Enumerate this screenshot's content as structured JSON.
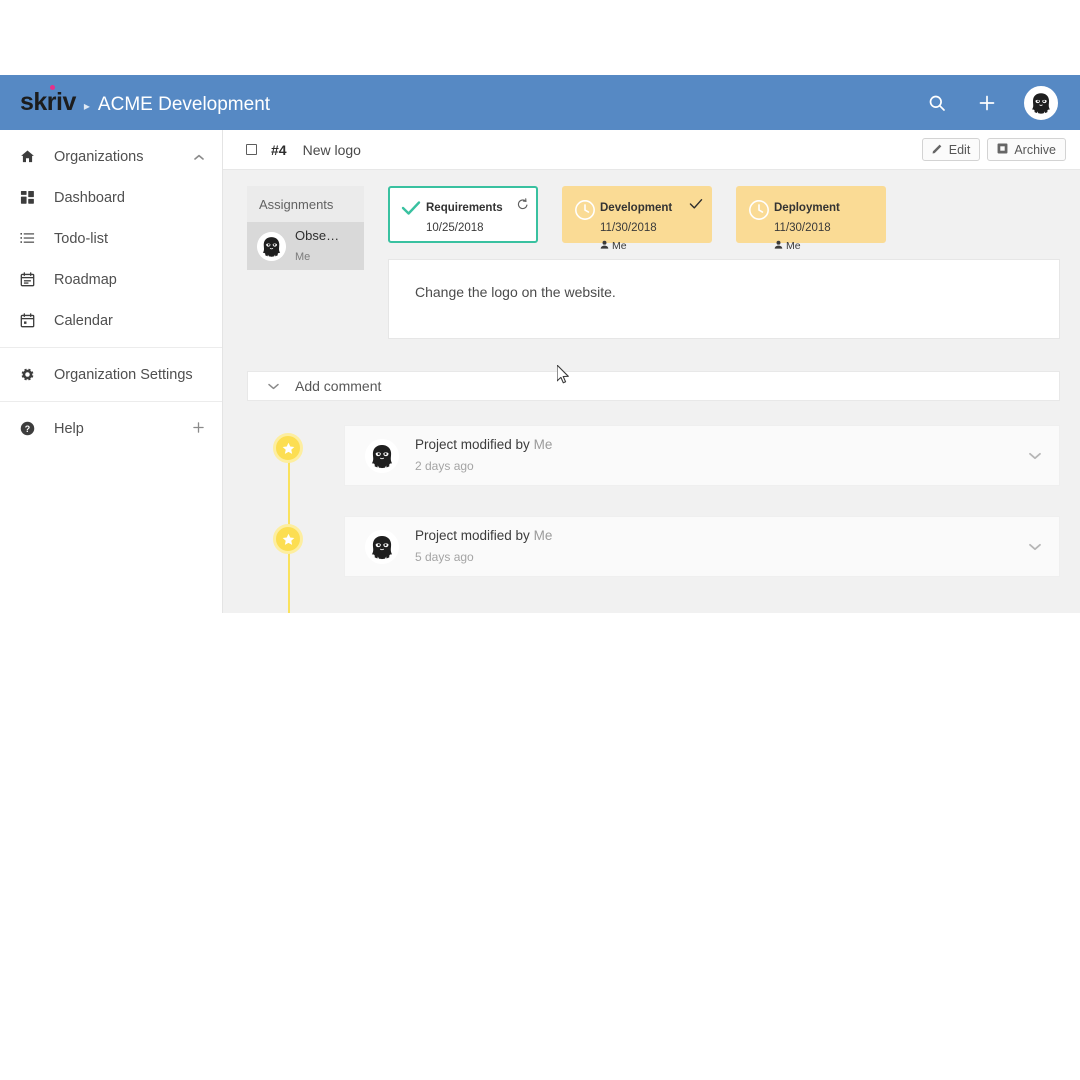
{
  "header": {
    "logo_text": "skriv",
    "separator": "▸",
    "project_title": "ACME Development",
    "search_icon": "search-icon",
    "add_icon": "plus-icon",
    "avatar_icon": "user-avatar"
  },
  "sidebar": {
    "groups": [
      {
        "items": [
          {
            "label": "Organizations",
            "icon": "home-icon",
            "tail": "chevron-up-icon"
          },
          {
            "label": "Dashboard",
            "icon": "grid-icon",
            "tail": ""
          },
          {
            "label": "Todo-list",
            "icon": "list-icon",
            "tail": ""
          },
          {
            "label": "Roadmap",
            "icon": "roadmap-calendar-icon",
            "tail": ""
          },
          {
            "label": "Calendar",
            "icon": "calendar-icon",
            "tail": ""
          }
        ]
      },
      {
        "items": [
          {
            "label": "Organization Settings",
            "icon": "gear-icon",
            "tail": ""
          }
        ]
      },
      {
        "items": [
          {
            "label": "Help",
            "icon": "question-circle-icon",
            "tail": "plus-icon"
          }
        ]
      }
    ]
  },
  "content_header": {
    "checkbox_checked": false,
    "issue_number": "#4",
    "issue_title": "New logo",
    "edit_label": "Edit",
    "edit_icon": "pencil-icon",
    "archive_label": "Archive",
    "archive_icon": "archive-icon"
  },
  "assignments": {
    "title": "Assignments",
    "rows": [
      {
        "name": "Obse…",
        "role": "Me",
        "avatar": "user-avatar"
      }
    ]
  },
  "status_cards": [
    {
      "title": "Requirements",
      "date": "10/25/2018",
      "assignee": "",
      "state": "done",
      "style": "green",
      "lead_icon": "check-icon",
      "corner_icon": "revert-icon",
      "border_color": "#39c1a0",
      "bg_color": "#ffffff"
    },
    {
      "title": "Development",
      "date": "11/30/2018",
      "assignee": "Me",
      "state": "in-progress",
      "style": "amber",
      "lead_icon": "clock-icon",
      "corner_icon": "check-icon",
      "border_color": "#fadb95",
      "bg_color": "#fadb95"
    },
    {
      "title": "Deployment",
      "date": "11/30/2018",
      "assignee": "Me",
      "state": "pending",
      "style": "amber",
      "lead_icon": "clock-icon",
      "corner_icon": "",
      "border_color": "#fadb95",
      "bg_color": "#fadb95"
    }
  ],
  "description": {
    "text": "Change the logo on the website."
  },
  "add_comment": {
    "label": "Add comment",
    "icon": "chevron-down-icon"
  },
  "activity_feed": [
    {
      "action": "Project modified by",
      "actor": "Me",
      "time": "2 days ago",
      "badge_icon": "star-icon",
      "expand_icon": "chevron-down-icon",
      "avatar": "user-avatar"
    },
    {
      "action": "Project modified by",
      "actor": "Me",
      "time": "5 days ago",
      "badge_icon": "star-icon",
      "expand_icon": "chevron-down-icon",
      "avatar": "user-avatar"
    }
  ],
  "theme": {
    "header_blue": "#5689c4",
    "accent_green": "#39c1a0",
    "accent_amber": "#fadb95",
    "accent_yellow": "#fcde52",
    "logo_dot_pink": "#e5308a",
    "canvas_gray": "#f1f1f1"
  }
}
